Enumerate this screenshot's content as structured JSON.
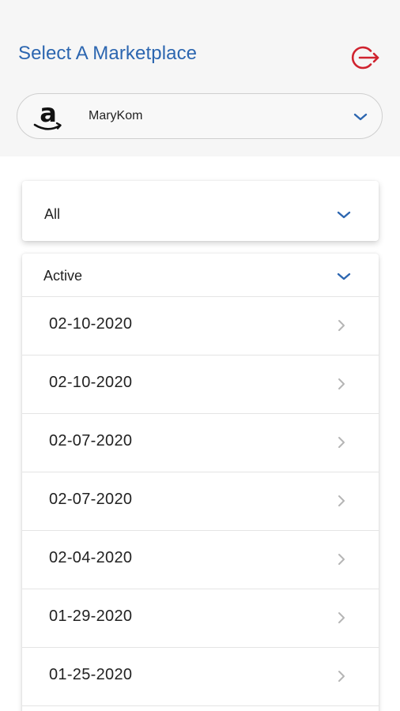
{
  "header": {
    "title": "Select A Marketplace",
    "logout_icon": "logout-icon",
    "accent_color": "#2c66b0",
    "logout_color": "#d0232f"
  },
  "marketplace": {
    "logo_icon": "amazon-logo-icon",
    "selected_account": "MaryKom"
  },
  "filter": {
    "selected": "All"
  },
  "list": {
    "status_label": "Active",
    "dates": [
      "02-10-2020",
      "02-10-2020",
      "02-07-2020",
      "02-07-2020",
      "02-04-2020",
      "01-29-2020",
      "01-25-2020"
    ]
  }
}
